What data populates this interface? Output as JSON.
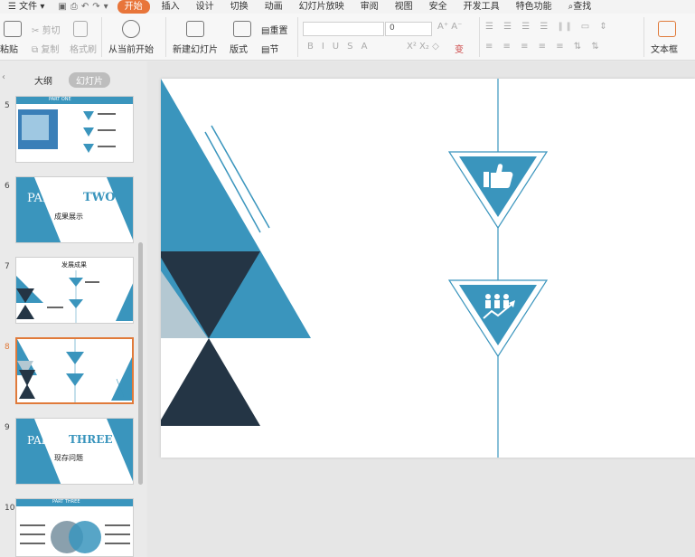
{
  "menu": {
    "file": "文件",
    "tabs": [
      "开始",
      "插入",
      "设计",
      "切换",
      "动画",
      "幻灯片放映",
      "审阅",
      "视图",
      "安全",
      "开发工具",
      "特色功能"
    ],
    "search": "查找"
  },
  "ribbon": {
    "paste": "粘贴",
    "cut": "剪切",
    "copy": "复制",
    "format_painter": "格式刷",
    "from_current": "从当前开始",
    "new_slide": "新建幻灯片",
    "layout": "版式",
    "reset": "重置",
    "section": "节",
    "font_size": "0",
    "textbox": "文本框"
  },
  "panel": {
    "tab_outline": "大纲",
    "tab_slides": "幻灯片",
    "slides": [
      {
        "num": "5",
        "title": "PART ONE"
      },
      {
        "num": "6",
        "part": "PART",
        "word": "TWO",
        "subtitle": "成果展示"
      },
      {
        "num": "7",
        "title": "发展成果"
      },
      {
        "num": "8"
      },
      {
        "num": "9",
        "part": "PART",
        "word": "THREE",
        "subtitle": "现存问题"
      },
      {
        "num": "10",
        "title": "PART THREE"
      }
    ]
  },
  "colors": {
    "accent_blue": "#3a95bd",
    "dark_navy": "#243545",
    "light_gray_blue": "#b4c8d2",
    "selected_border": "#e07a3a",
    "start_tab": "#e8753a"
  }
}
